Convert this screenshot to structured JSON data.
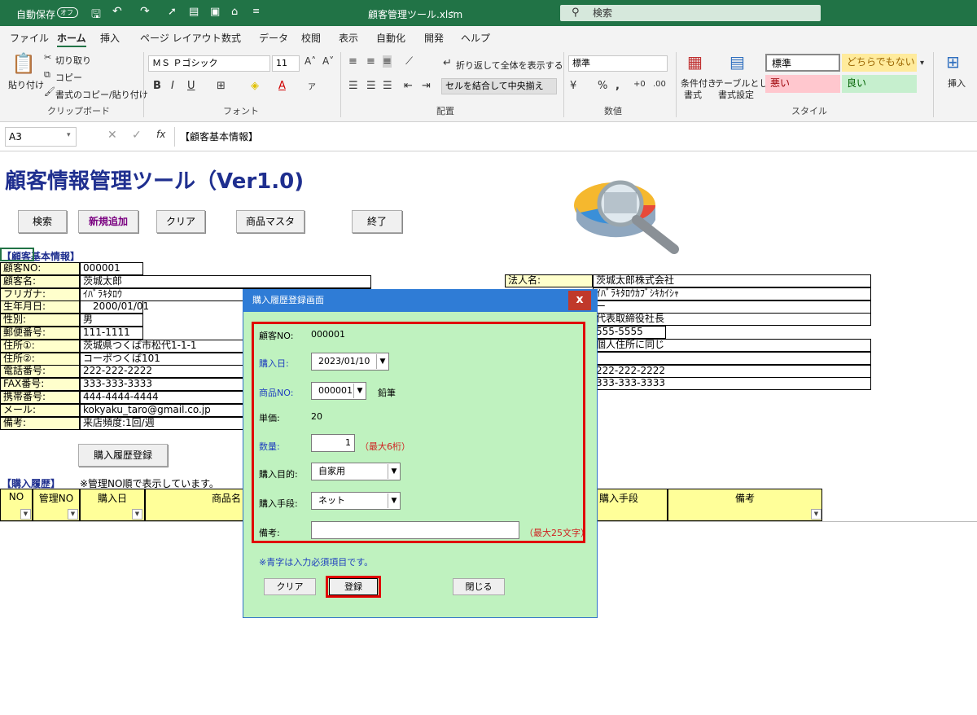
{
  "titlebar": {
    "autosave_label": "自動保存",
    "autosave_toggle": "オフ",
    "filename": "顧客管理ツール.xlsm",
    "search_placeholder": "検索"
  },
  "tabs": [
    "ファイル",
    "ホーム",
    "挿入",
    "ページ レイアウト",
    "数式",
    "データ",
    "校閲",
    "表示",
    "自動化",
    "開発",
    "ヘルプ"
  ],
  "ribbon": {
    "clipboard": {
      "paste": "貼り付け",
      "cut": "切り取り",
      "copy": "コピー",
      "format_painter": "書式のコピー/貼り付け",
      "group": "クリップボード"
    },
    "font": {
      "name": "ＭＳ Ｐゴシック",
      "size": "11",
      "group": "フォント"
    },
    "alignment": {
      "wrap": "折り返して全体を表示する",
      "merge": "セルを結合して中央揃え",
      "group": "配置"
    },
    "number": {
      "format": "標準",
      "group": "数値"
    },
    "styles": {
      "conditional": "条件付き",
      "conditional2": "書式",
      "table": "テーブルとして",
      "table2": "書式設定",
      "normal": "標準",
      "neutral": "どちらでもない",
      "bad": "悪い",
      "good": "良い",
      "group": "スタイル"
    },
    "cells": {
      "insert": "挿入"
    }
  },
  "formula_bar": {
    "cell_ref": "A3",
    "formula": "【顧客基本情報】"
  },
  "sheet": {
    "title": "顧客情報管理ツール（Ver1.0)",
    "buttons": {
      "search": "検索",
      "add": "新規追加",
      "clear": "クリア",
      "product_master": "商品マスタ",
      "exit": "終了",
      "purchase_register": "購入履歴登録"
    },
    "basic_section": "【顧客基本情報】",
    "fields": [
      {
        "label": "顧客NO:",
        "value": "000001"
      },
      {
        "label": "顧客名:",
        "value": "茨城太郎"
      },
      {
        "label": "フリガナ:",
        "value": "ｲﾊﾞﾗｷﾀﾛｳ"
      },
      {
        "label": "生年月日:",
        "value": "　2000/01/01"
      },
      {
        "label": "性別:",
        "value": "男"
      },
      {
        "label": "郵便番号:",
        "value": "111-1111"
      },
      {
        "label": "住所①:",
        "value": "茨城県つくば市松代1-1-1"
      },
      {
        "label": "住所②:",
        "value": "コーポつくば101"
      },
      {
        "label": "電話番号:",
        "value": "222-222-2222"
      },
      {
        "label": "FAX番号:",
        "value": "333-333-3333"
      },
      {
        "label": "携帯番号:",
        "value": "444-4444-4444"
      },
      {
        "label": "メール:",
        "value": "kokyaku_taro@gmail.co.jp"
      },
      {
        "label": "備考:",
        "value": "来店頻度:1回/週"
      }
    ],
    "corp": {
      "label": "法人名:",
      "values": [
        "茨城太郎株式会社",
        "ｲﾊﾞﾗｷﾀﾛｳｶﾌﾞｼｷｶｲｼｬ",
        "ー",
        "代表取締役社長",
        "555-5555",
        "個人住所に同じ",
        "",
        "222-222-2222",
        "333-333-3333"
      ]
    },
    "history_section": "【購入履歴】",
    "history_note": "※管理NO順で表示しています。",
    "columns": [
      "NO",
      "管理NO",
      "購入日",
      "商品名",
      "購入手段",
      "備考"
    ]
  },
  "dialog": {
    "title": "購入履歴登録画面",
    "close": "x",
    "customer_no_label": "顧客NO:",
    "customer_no": "000001",
    "date_label": "購入日:",
    "date": "2023/01/10",
    "product_label": "商品NO:",
    "product_no": "000001",
    "product_name": "鉛筆",
    "price_label": "単価:",
    "price": "20",
    "qty_label": "数量:",
    "qty": "1",
    "qty_note": "（最大6桁）",
    "purpose_label": "購入目的:",
    "purpose": "自家用",
    "method_label": "購入手段:",
    "method": "ネット",
    "remarks_label": "備考:",
    "remarks": "",
    "remarks_note": "（最大25文字）",
    "required_note": "※青字は入力必須項目です。",
    "btn_clear": "クリア",
    "btn_register": "登録",
    "btn_close": "閉じる"
  }
}
